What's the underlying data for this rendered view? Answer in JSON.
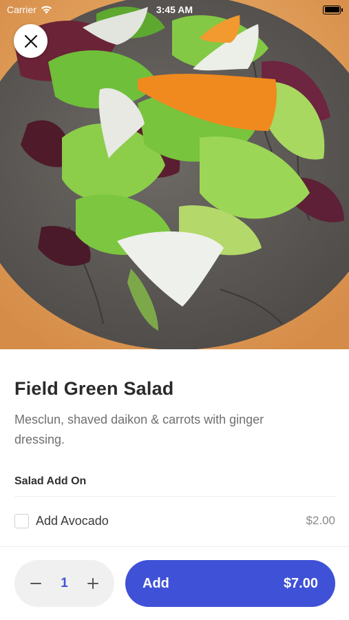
{
  "status_bar": {
    "carrier": "Carrier",
    "time": "3:45 AM",
    "icons": [
      "wifi-icon",
      "battery-icon"
    ]
  },
  "close_button": {
    "icon": "close-icon"
  },
  "item": {
    "title": "Field Green Salad",
    "description": "Mesclun, shaved daikon & carrots with ginger dressing."
  },
  "addons": {
    "section_title": "Salad Add On",
    "options": [
      {
        "label": "Add Avocado",
        "price": "$2.00",
        "checked": false
      }
    ]
  },
  "footer": {
    "quantity": "1",
    "decrement_icon": "minus-icon",
    "increment_icon": "plus-icon",
    "add_label": "Add",
    "total": "$7.00"
  },
  "colors": {
    "accent": "#3f51d7",
    "quantity_text": "#4152d4",
    "stepper_bg": "#f0f0f0"
  }
}
